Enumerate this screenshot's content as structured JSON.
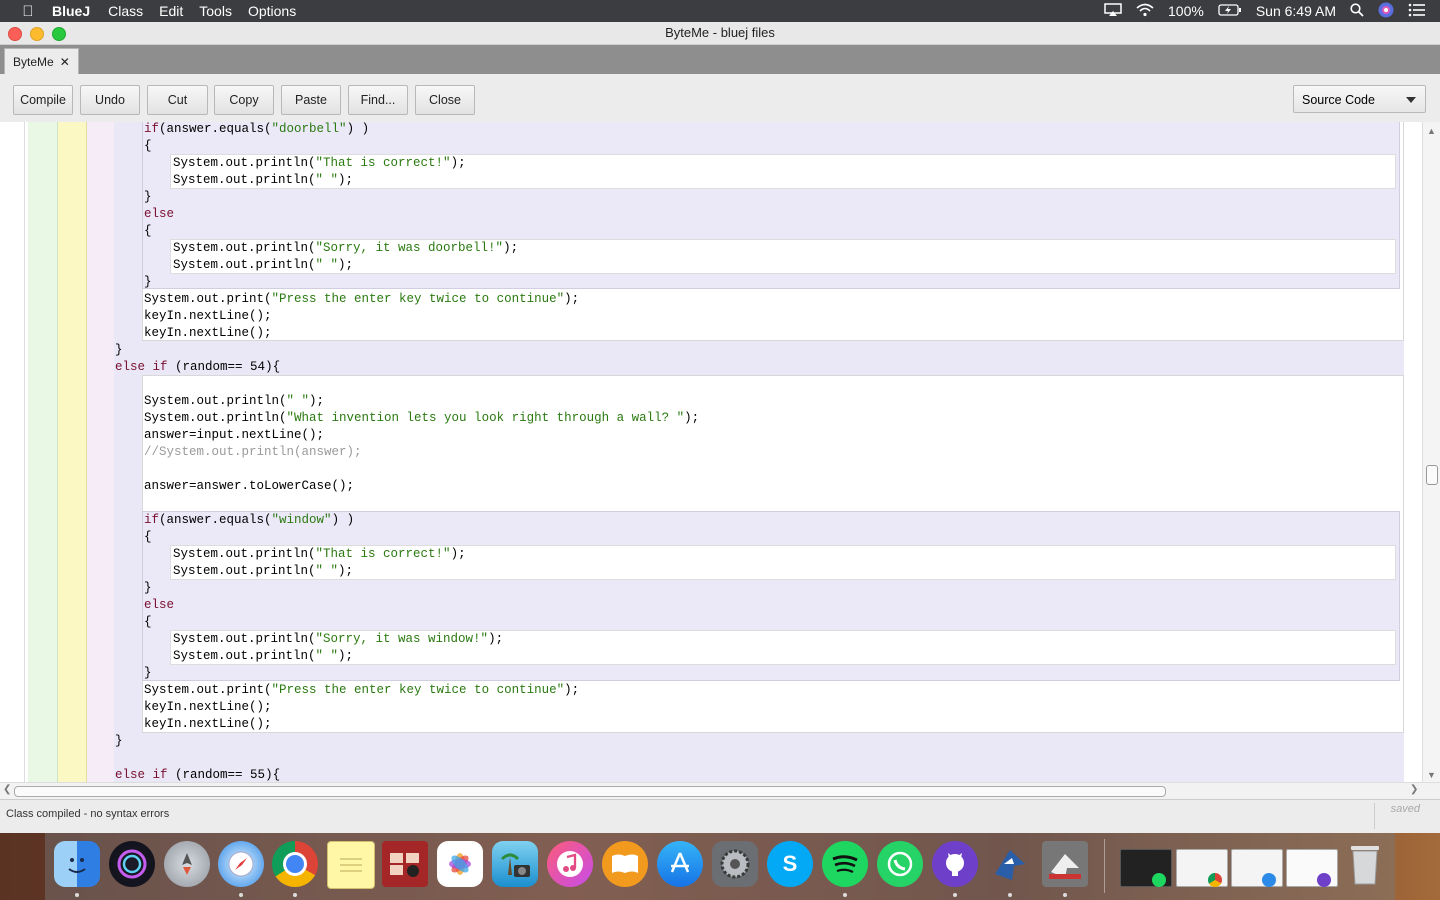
{
  "menubar": {
    "app": "BlueJ",
    "items": [
      "Class",
      "Edit",
      "Tools",
      "Options"
    ],
    "battery": "100%",
    "clock": "Sun 6:49 AM"
  },
  "window": {
    "title": "ByteMe - bluej files",
    "tab": "ByteMe",
    "tab_close": "✕"
  },
  "toolbar": {
    "compile": "Compile",
    "undo": "Undo",
    "cut": "Cut",
    "copy": "Copy",
    "paste": "Paste",
    "find": "Find...",
    "close": "Close",
    "view_mode": "Source Code"
  },
  "code_lines": [
    "if(answer.equals(\"doorbell\") )",
    "{",
    "System.out.println(\"That is correct!\");",
    "System.out.println(\" \");",
    "}",
    "else",
    "{",
    "System.out.println(\"Sorry, it was doorbell!\");",
    "System.out.println(\" \");",
    "}",
    "System.out.print(\"Press the enter key twice to continue\");",
    "keyIn.nextLine();",
    "keyIn.nextLine();",
    "}",
    "else if (random== 54){",
    "",
    "System.out.println(\" \");",
    "System.out.println(\"What invention lets you look right through a wall? \");",
    "answer=input.nextLine();",
    "//System.out.println(answer);",
    "",
    "answer=answer.toLowerCase();",
    "",
    "if(answer.equals(\"window\") )",
    "{",
    "System.out.println(\"That is correct!\");",
    "System.out.println(\" \");",
    "}",
    "else",
    "{",
    "System.out.println(\"Sorry, it was window!\");",
    "System.out.println(\" \");",
    "}",
    "System.out.print(\"Press the enter key twice to continue\");",
    "keyIn.nextLine();",
    "keyIn.nextLine();",
    "}",
    "",
    "else if (random== 55){"
  ],
  "status": {
    "message": "Class compiled - no syntax errors",
    "saved": "saved"
  },
  "colors": {
    "string": "#2a7a10",
    "keyword": "#7a1030",
    "comment": "#9a9a9a"
  },
  "dock": {
    "icons": [
      "finder-icon",
      "siri-icon",
      "launchpad-icon",
      "safari-icon",
      "chrome-icon",
      "notes-icon",
      "photo-booth-icon",
      "photos-icon",
      "iphoto-icon",
      "itunes-icon",
      "ibooks-icon",
      "app-store-icon",
      "system-preferences-icon",
      "skype-icon",
      "spotify-icon",
      "whatsapp-icon",
      "github-desktop-icon",
      "bluej-icon",
      "greenfoot-icon",
      "window-thumbnail-1",
      "window-thumbnail-2",
      "window-thumbnail-3",
      "window-thumbnail-4",
      "trash-icon"
    ]
  }
}
